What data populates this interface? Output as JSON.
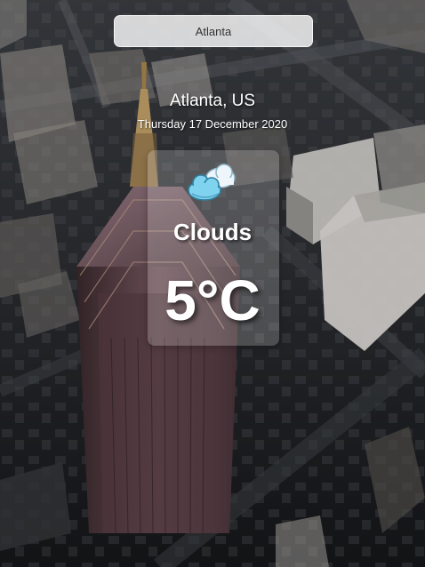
{
  "search": {
    "value": "Atlanta",
    "icon": "search-field"
  },
  "location": {
    "text": "Atlanta, US"
  },
  "date": {
    "text": "Thursday 17 December 2020"
  },
  "weather": {
    "icon": "clouds-icon",
    "condition": "Clouds",
    "temperature": "5°C"
  },
  "colors": {
    "text": "#ffffff",
    "card": "rgba(255,255,255,0.20)",
    "search_bg": "rgba(255,255,255,0.80)"
  }
}
